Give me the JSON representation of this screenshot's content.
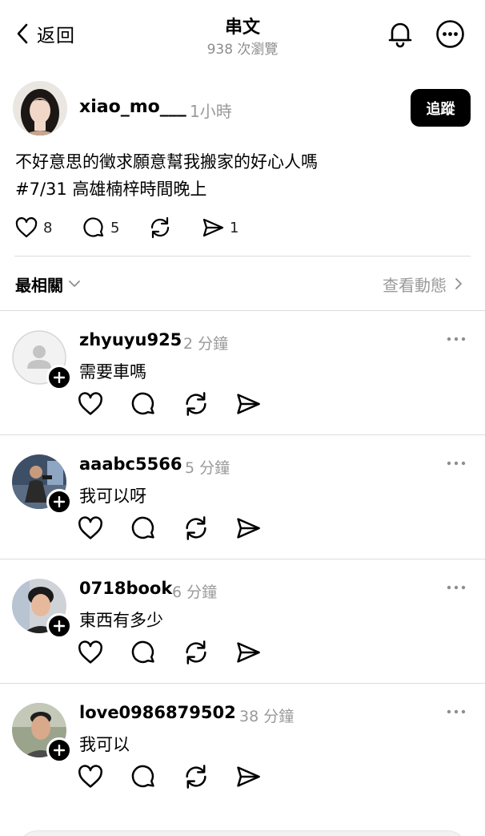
{
  "header": {
    "back_label": "返回",
    "title": "串文",
    "views": "938 次瀏覽"
  },
  "post": {
    "username": "xiao_mo___",
    "time": "1小時",
    "follow_label": "追蹤",
    "text_line1": "不好意思的徵求願意幫我搬家的好心人嗎",
    "text_line2": "#7/31 高雄楠梓時間晚上",
    "likes": "8",
    "comments": "5",
    "shares": "1"
  },
  "sort": {
    "label": "最相關",
    "activity_label": "查看動態"
  },
  "replies": [
    {
      "username": "zhyuyu925",
      "time": "2 分鐘",
      "text": "需要車嗎"
    },
    {
      "username": "aaabc5566",
      "time": "5 分鐘",
      "text": "我可以呀"
    },
    {
      "username": "0718book",
      "time": "6 分鐘",
      "text": "東西有多少"
    },
    {
      "username": "love0986879502",
      "time": "38 分鐘",
      "text": "我可以"
    }
  ]
}
